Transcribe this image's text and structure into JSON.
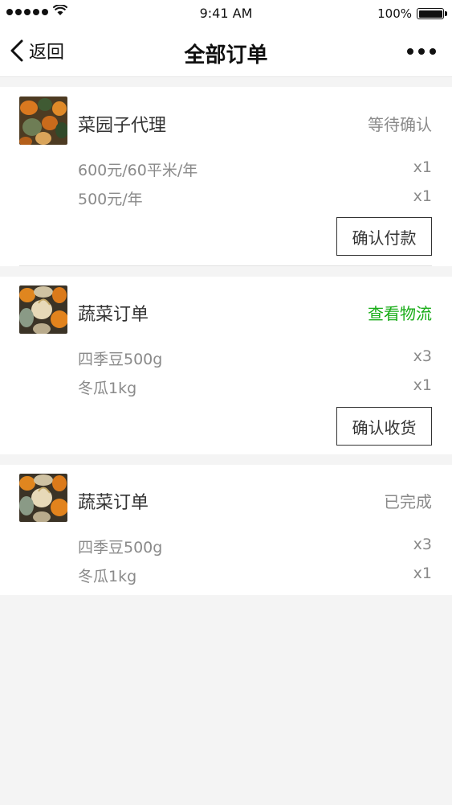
{
  "status_bar": {
    "time": "9:41 AM",
    "battery": "100%"
  },
  "nav": {
    "back_label": "返回",
    "title": "全部订单"
  },
  "orders": [
    {
      "shop": "菜园子代理",
      "status": "等待确认",
      "status_color": "#8a8a8a",
      "items": [
        {
          "name": "600元/60平米/年",
          "qty": "x1"
        },
        {
          "name": "500元/年",
          "qty": "x1"
        }
      ],
      "action": "确认付款"
    },
    {
      "shop": "蔬菜订单",
      "status": "查看物流",
      "status_color": "#1aad19",
      "items": [
        {
          "name": "四季豆500g",
          "qty": "x3"
        },
        {
          "name": "冬瓜1kg",
          "qty": "x1"
        }
      ],
      "action": "确认收货"
    },
    {
      "shop": "蔬菜订单",
      "status": "已完成",
      "status_color": "#8a8a8a",
      "items": [
        {
          "name": "四季豆500g",
          "qty": "x3"
        },
        {
          "name": "冬瓜1kg",
          "qty": "x1"
        }
      ]
    }
  ]
}
